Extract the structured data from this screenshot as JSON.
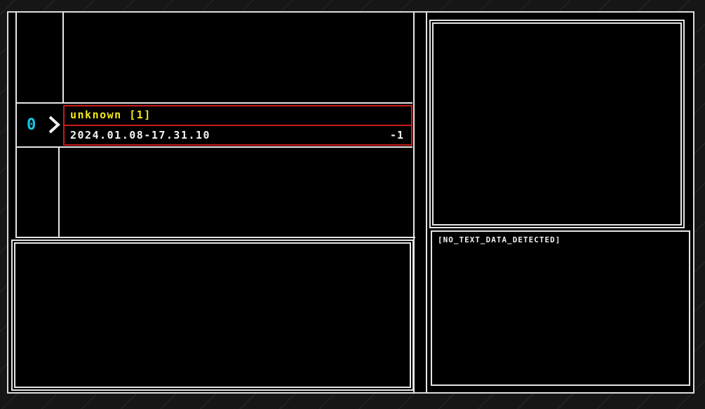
{
  "entry": {
    "index": "0",
    "title": "unknown [1]",
    "date": "2024.01.08-17.31.10",
    "value": "-1"
  },
  "details": {
    "text_status": "[NO_TEXT_DATA_DETECTED]"
  },
  "colors": {
    "selection": "#cc1a1a",
    "title": "#f2ea18",
    "index": "#19c7e6",
    "lines": "#e6e6e6"
  }
}
